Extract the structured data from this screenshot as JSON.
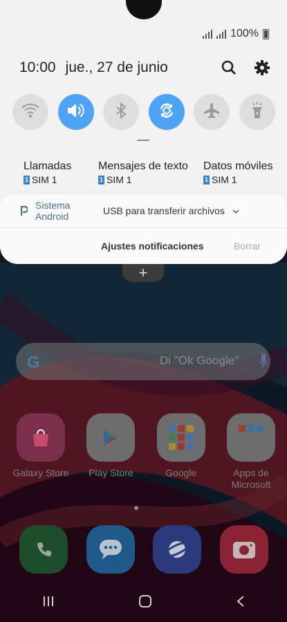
{
  "status_bar": {
    "battery_text": "100%"
  },
  "panel": {
    "time": "10:00",
    "date": "jue., 27 de junio",
    "quick_toggles": [
      {
        "name": "wifi",
        "on": false
      },
      {
        "name": "sound",
        "on": true
      },
      {
        "name": "bluetooth",
        "on": false
      },
      {
        "name": "auto-rotate",
        "on": true
      },
      {
        "name": "airplane-mode",
        "on": false
      },
      {
        "name": "flashlight",
        "on": false
      }
    ],
    "sim_settings": [
      {
        "label": "Llamadas",
        "sim": "SIM 1"
      },
      {
        "label": "Mensajes de texto",
        "sim": "SIM 1"
      },
      {
        "label": "Datos móviles",
        "sim": "SIM 1"
      }
    ],
    "sim_badge": "1",
    "notification": {
      "app": "Sistema Android",
      "message": "USB para transferir archivos"
    },
    "footer": {
      "settings_label": "Ajustes notificaciones",
      "clear_label": "Borrar"
    }
  },
  "home": {
    "search_hint": "Di \"Ok Google\"",
    "search_logo": "G",
    "apps": [
      {
        "name": "Galaxy Store",
        "icon": "galaxy-store-icon"
      },
      {
        "name": "Play Store",
        "icon": "play-store-icon"
      },
      {
        "name": "Google",
        "icon": "google-folder-icon"
      },
      {
        "name": "Apps de\nMicrosoft",
        "icon": "microsoft-folder-icon"
      }
    ],
    "dock": [
      {
        "icon": "phone-icon",
        "color": "#1e4d2b"
      },
      {
        "icon": "messages-icon",
        "color": "#1f5a8a"
      },
      {
        "icon": "internet-icon",
        "color": "#2a3a7a"
      },
      {
        "icon": "camera-icon",
        "color": "#8a2434"
      }
    ]
  },
  "colors": {
    "accent": "#4ea3f5",
    "panel_bg": "#f2f2f2"
  }
}
